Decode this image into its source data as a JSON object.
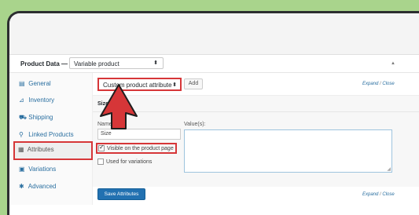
{
  "panel": {
    "title": "Product Data —",
    "product_type": "Variable product"
  },
  "sidebar": {
    "items": [
      {
        "label": "General",
        "icon": "settings-icon",
        "glyph": "▤"
      },
      {
        "label": "Inventory",
        "icon": "inventory-icon",
        "glyph": "⊿"
      },
      {
        "label": "Shipping",
        "icon": "truck-icon",
        "glyph": "⛟"
      },
      {
        "label": "Linked Products",
        "icon": "link-icon",
        "glyph": "⚲"
      },
      {
        "label": "Attributes",
        "icon": "list-icon",
        "glyph": "▦"
      },
      {
        "label": "Variations",
        "icon": "grid-icon",
        "glyph": "▣"
      },
      {
        "label": "Advanced",
        "icon": "gear-icon",
        "glyph": "✱"
      }
    ]
  },
  "attributes": {
    "selected_attribute": "Custom product attribute",
    "add_label": "Add",
    "expand_label": "Expand",
    "separator": "/",
    "close_label": "Close",
    "attribute_title": "Size",
    "name_label": "Name:",
    "name_value": "Size",
    "values_label": "Value(s):",
    "values_value": "",
    "visible_label": "Visible on the product page",
    "visible_checked": true,
    "variations_label": "Used for variations",
    "variations_checked": false,
    "save_label": "Save Attributes"
  },
  "colors": {
    "highlight": "#d63638",
    "primary_button": "#2271b1",
    "link": "#2a6fa0",
    "background": "#a9d48c"
  }
}
